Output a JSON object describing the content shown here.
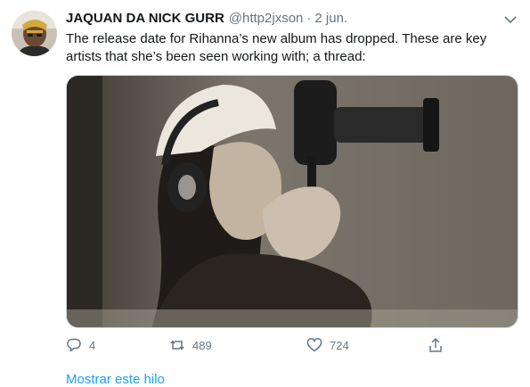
{
  "tweet": {
    "display_name": "JAQUAN DA NICK GURR",
    "handle": "@http2jxson",
    "separator": "·",
    "time": "2 jun.",
    "text": "The release date for Rihanna’s new album has dropped. These are key artists that she’s been seen working with; a thread:",
    "avatar_icon": "user-avatar",
    "menu_icon": "chevron-down-icon",
    "media_icon": "studio-photo"
  },
  "actions": {
    "reply": {
      "icon": "reply-icon",
      "count": "4"
    },
    "retweet": {
      "icon": "retweet-icon",
      "count": "489"
    },
    "like": {
      "icon": "heart-icon",
      "count": "724"
    },
    "share": {
      "icon": "share-icon"
    }
  },
  "show_thread_label": "Mostrar este hilo",
  "colors": {
    "text": "#14171a",
    "muted": "#657786",
    "link": "#1da1f2",
    "border": "#ccd6dd"
  }
}
